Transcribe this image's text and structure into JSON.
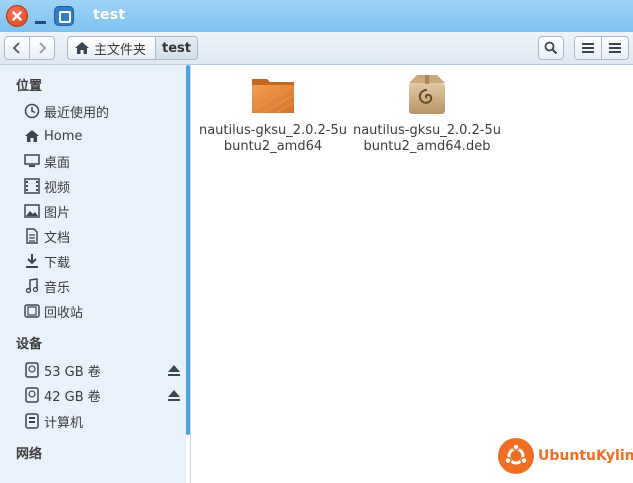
{
  "window": {
    "title": "test"
  },
  "toolbar": {
    "breadcrumb": [
      {
        "label": "主文件夹",
        "icon": "home-icon"
      },
      {
        "label": "test"
      }
    ]
  },
  "sidebar": {
    "sections": [
      {
        "heading": "位置",
        "items": [
          {
            "label": "最近使用的",
            "icon": "clock-icon"
          },
          {
            "label": "Home",
            "icon": "home-icon"
          },
          {
            "label": "桌面",
            "icon": "desktop-icon"
          },
          {
            "label": "视频",
            "icon": "video-icon"
          },
          {
            "label": "图片",
            "icon": "picture-icon"
          },
          {
            "label": "文档",
            "icon": "document-icon"
          },
          {
            "label": "下载",
            "icon": "download-icon"
          },
          {
            "label": "音乐",
            "icon": "music-icon"
          },
          {
            "label": "回收站",
            "icon": "trash-icon"
          }
        ]
      },
      {
        "heading": "设备",
        "items": [
          {
            "label": "53 GB 卷",
            "icon": "drive-icon"
          },
          {
            "label": "42 GB 卷",
            "icon": "drive-icon"
          },
          {
            "label": "计算机",
            "icon": "computer-icon"
          }
        ]
      },
      {
        "heading": "网络",
        "items": []
      }
    ]
  },
  "files": [
    {
      "name": "nautilus-gksu_2.0.2-5ubuntu2_amd64",
      "type": "folder",
      "icon": "folder-icon"
    },
    {
      "name": "nautilus-gksu_2.0.2-5ubuntu2_amd64.deb",
      "type": "deb-package",
      "icon": "debian-package-icon"
    }
  ],
  "watermark": {
    "text": "UbuntuKylin"
  },
  "colors": {
    "titlebar": "#8fcaf2",
    "sidebar": "#e9f2fa",
    "accent": "#4aa0e0",
    "folder": "#e8873a",
    "logo": "#f16d22"
  }
}
